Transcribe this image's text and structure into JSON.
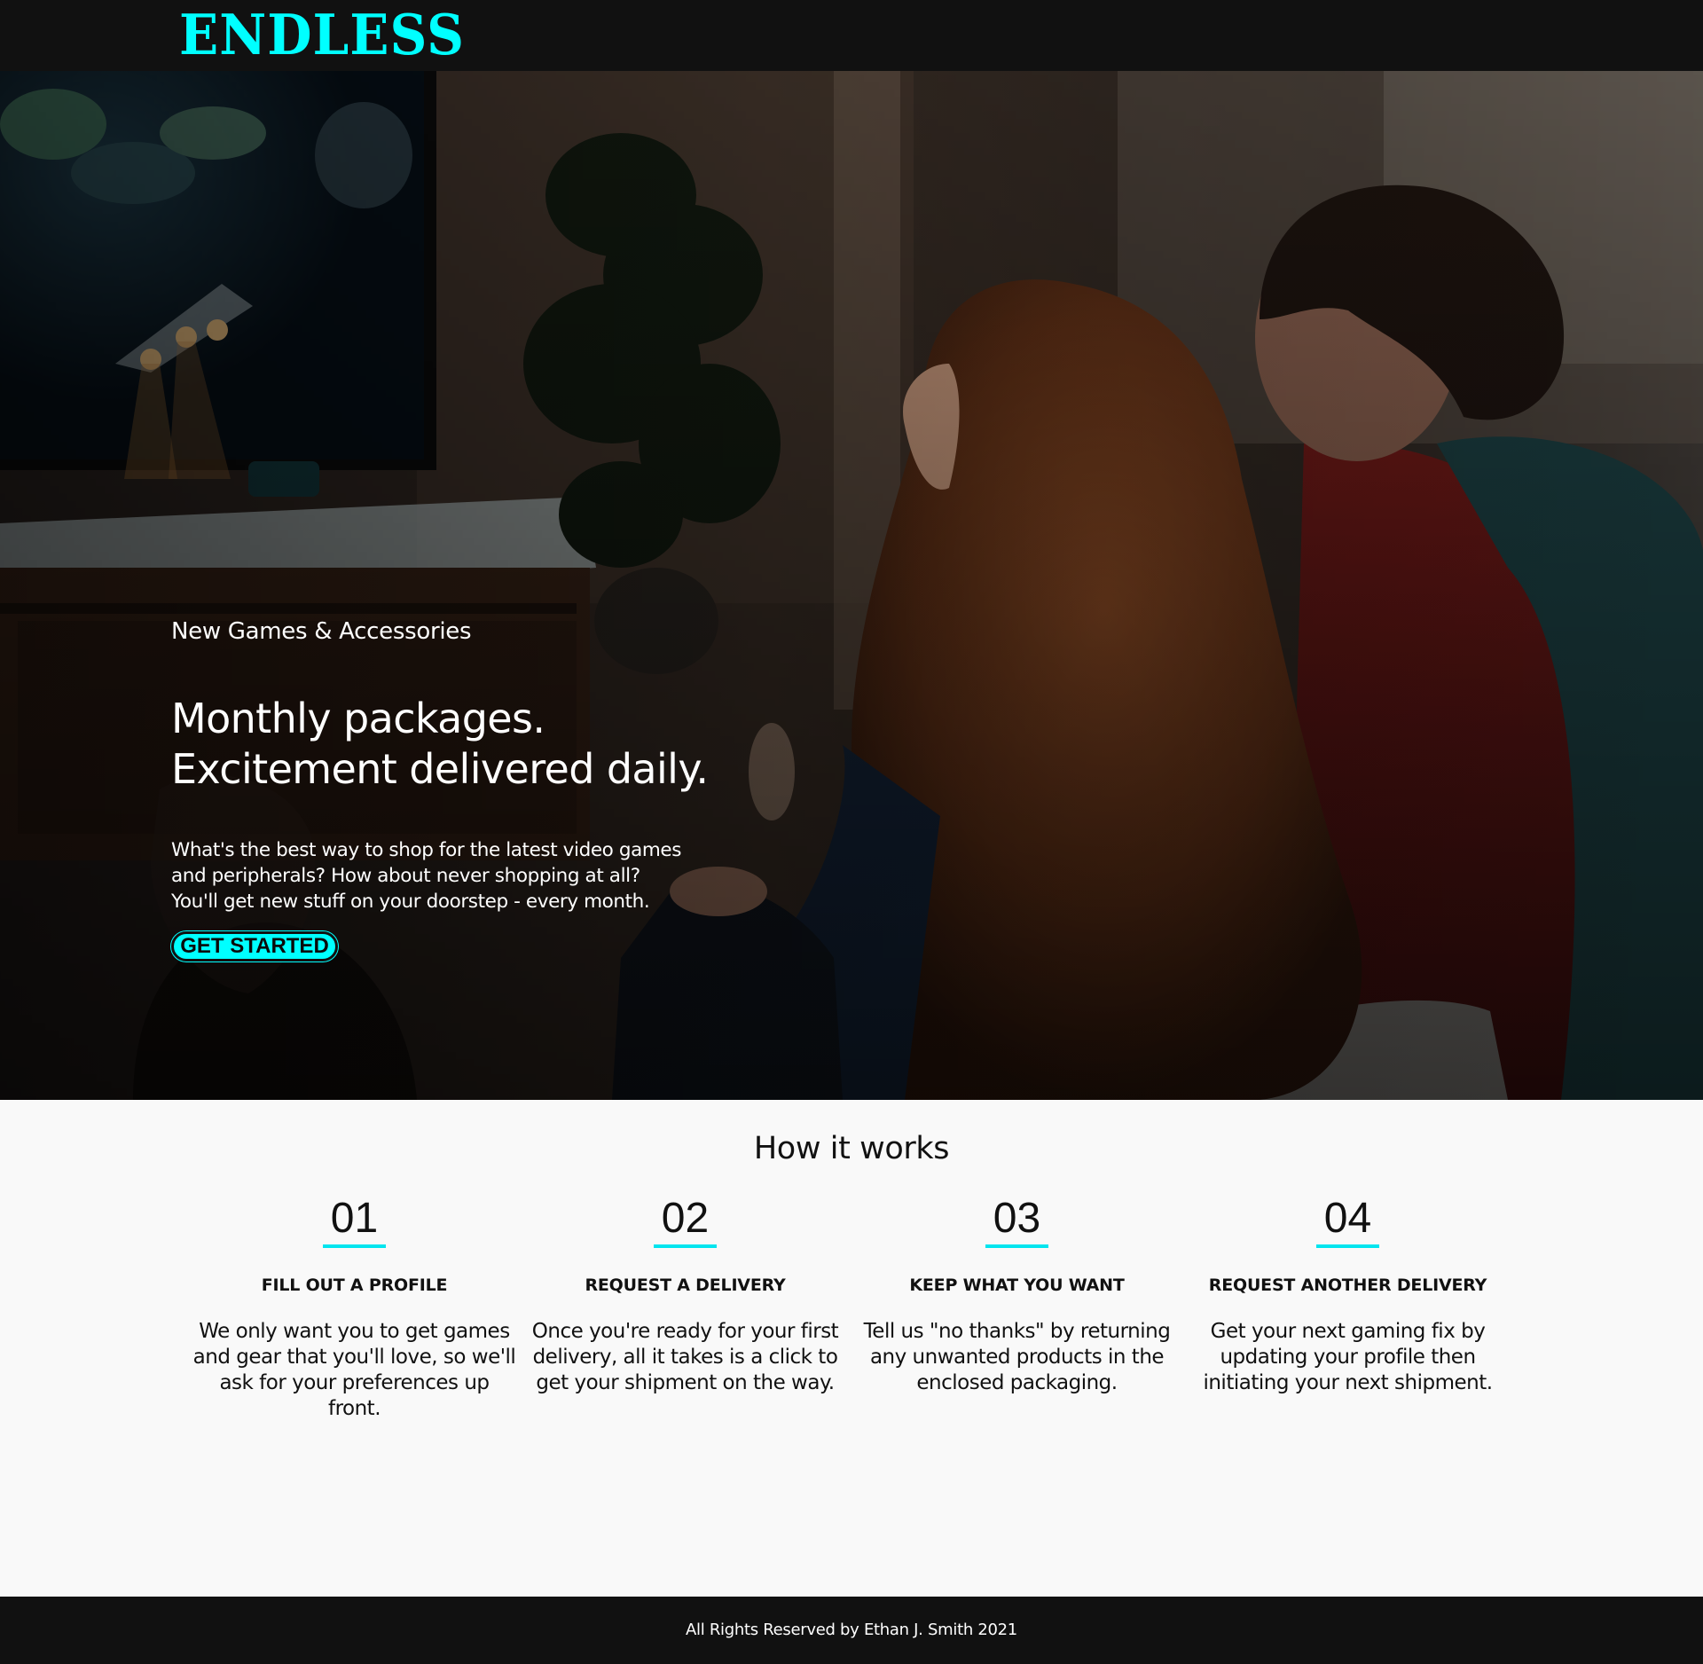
{
  "header": {
    "logo": "ENDLESS"
  },
  "colors": {
    "accent": "#00ffff",
    "header_bg": "#111111",
    "page_bg": "#f9f9f9"
  },
  "hero": {
    "eyebrow": "New Games & Accessories",
    "headline_line1": "Monthly packages.",
    "headline_line2": "Excitement delivered daily.",
    "intro_line1": "What's the best way to shop for the latest video games",
    "intro_line2": "and peripherals? How about never shopping at all?",
    "intro_line3": "You'll get new stuff on your doorstep - every month.",
    "cta_label": "GET STARTED"
  },
  "how_it_works": {
    "title": "How it works",
    "steps": [
      {
        "number": "01",
        "title": "FILL OUT A PROFILE",
        "text": "We only want you to get games and gear that you'll love, so we'll ask for your preferences up front."
      },
      {
        "number": "02",
        "title": "REQUEST A DELIVERY",
        "text": "Once you're ready for your first delivery, all it takes is a click to get your shipment on the way."
      },
      {
        "number": "03",
        "title": "KEEP WHAT YOU WANT",
        "text": "Tell us \"no thanks\" by returning any unwanted products in the enclosed packaging."
      },
      {
        "number": "04",
        "title": "REQUEST ANOTHER DELIVERY",
        "text": "Get your next gaming fix by updating your profile then initiating your next shipment."
      }
    ]
  },
  "footer": {
    "copyright": "All Rights Reserved by Ethan J. Smith 2021"
  }
}
